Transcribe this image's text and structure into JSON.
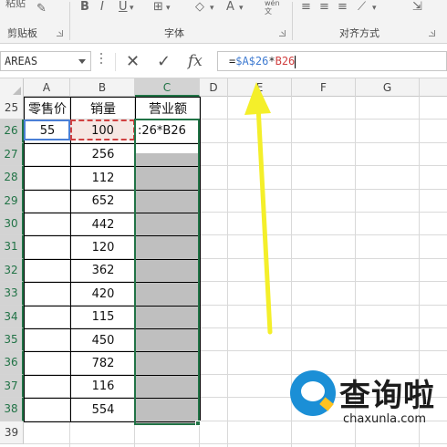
{
  "ribbon": {
    "clipboard_label": "剪贴板",
    "font_label": "字体",
    "alignment_label": "对齐方式",
    "top_partial_text": "粘贴",
    "wrap_icon_text": "wén\n文",
    "bold_label": "B",
    "italic_label": "I",
    "underline_label": "U",
    "font_color_label": "A"
  },
  "formula_bar": {
    "name_box": "AREAS",
    "cancel_symbol": "✕",
    "enter_symbol": "✓",
    "fx_symbol": "fx",
    "formula_prefix": "=",
    "formula_ref1": "$A$26",
    "formula_op": "*",
    "formula_ref2": "B26"
  },
  "columns": [
    "A",
    "B",
    "C",
    "D",
    "E",
    "F",
    "G"
  ],
  "rows": [
    "25",
    "26",
    "27",
    "28",
    "29",
    "30",
    "31",
    "32",
    "33",
    "34",
    "35",
    "36",
    "37",
    "38",
    "39"
  ],
  "headers": {
    "A": "零售价",
    "B": "销量",
    "C": "营业额"
  },
  "cells": {
    "A26": "55",
    "C26_edit": ":26*B26",
    "B_values": [
      "100",
      "256",
      "112",
      "652",
      "442",
      "120",
      "362",
      "420",
      "115",
      "450",
      "782",
      "116",
      "554"
    ]
  },
  "watermark": {
    "cn": "查询啦",
    "en": "chaxunla.com"
  },
  "colors": {
    "selection_green": "#217346",
    "ref_blue": "#3f7bd1",
    "ref_red": "#d04040",
    "fill_gray": "#bfbfbf",
    "arrow_yellow": "#f4ef2a"
  }
}
